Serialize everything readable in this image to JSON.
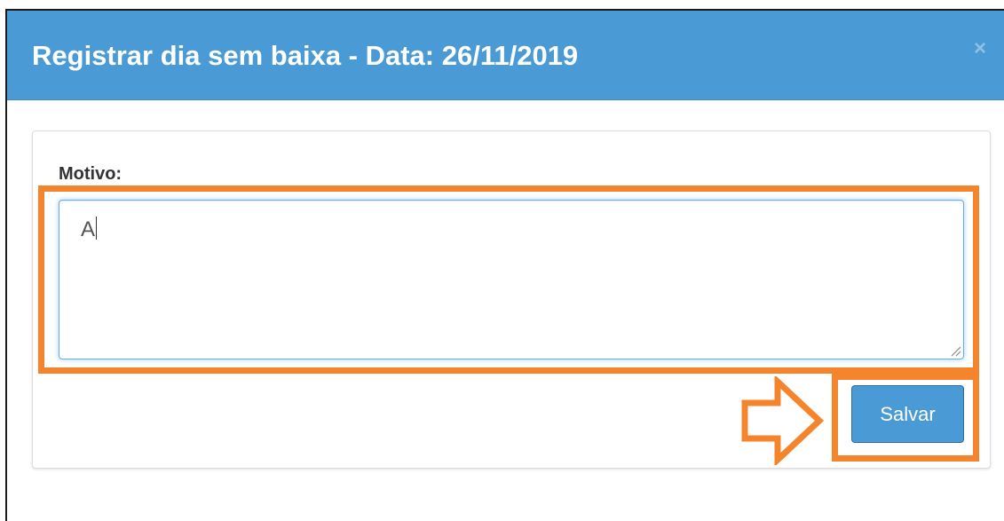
{
  "modal": {
    "title": "Registrar dia sem baixa - Data: 26/11/2019",
    "close_symbol": "×"
  },
  "form": {
    "label": "Motivo:",
    "textarea_value": "A"
  },
  "actions": {
    "save_label": "Salvar"
  },
  "icons": {
    "close": "close-icon",
    "resize": "resize-grip-icon",
    "annotation_arrow": "arrow-right-icon"
  },
  "colors": {
    "header_bg": "#4a9bd5",
    "button_bg": "#4a9bd5",
    "annotation": "#f5852c",
    "focus_border": "#66afe9"
  }
}
